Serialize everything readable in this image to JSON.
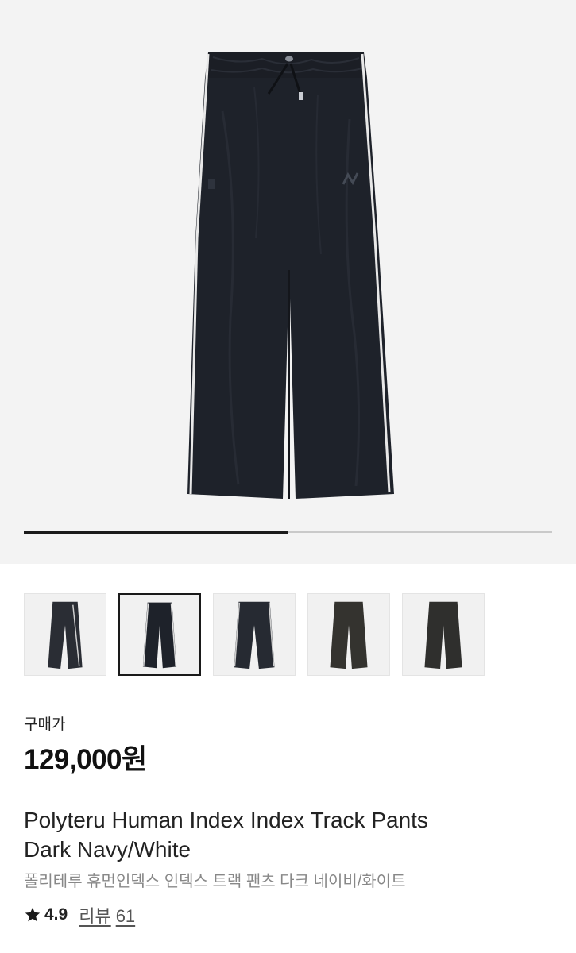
{
  "gallery": {
    "main_image": "dark-navy-track-pants-photo",
    "image_progress": 0.5,
    "progress_color": "#1a1a1a",
    "thumbnails": [
      {
        "image": "pants-navy-side",
        "selected": false
      },
      {
        "image": "pants-navy-front",
        "selected": true
      },
      {
        "image": "pants-navy-flat",
        "selected": false
      },
      {
        "image": "pants-charcoal-flat",
        "selected": false
      },
      {
        "image": "pants-charcoal-flat-2",
        "selected": false
      }
    ]
  },
  "product": {
    "price_label": "구매가",
    "price": "129,000원",
    "title_line1": "Polyteru Human Index Index Track Pants",
    "title_line2": "Dark Navy/White",
    "title_ko": "폴리테루 휴먼인덱스 인덱스 트랙 팬츠 다크 네이비/화이트",
    "rating_icon": "star-icon",
    "rating": "4.9",
    "review_label": "리뷰",
    "review_count": "61"
  }
}
